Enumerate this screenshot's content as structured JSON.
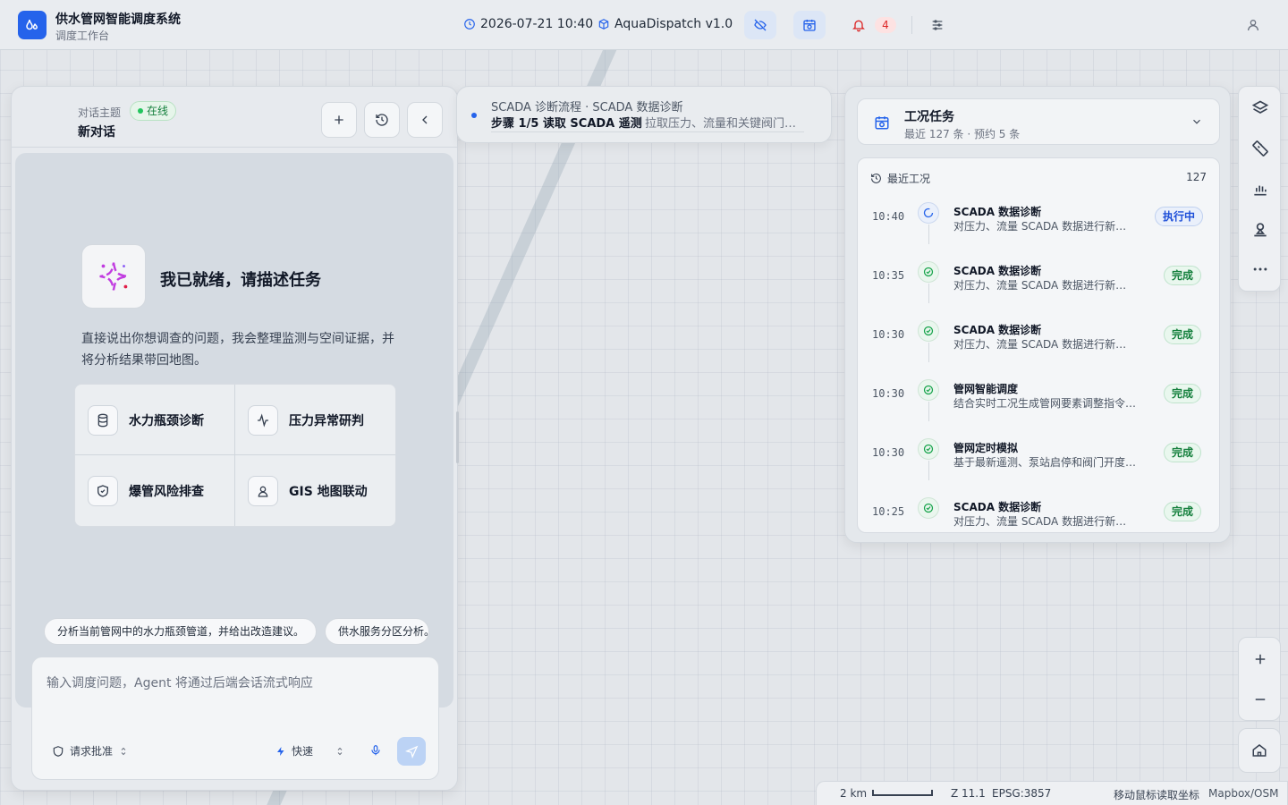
{
  "app": {
    "title": "供水管网智能调度系统",
    "subtitle": "调度工作台"
  },
  "topbar": {
    "datetime": "2026-07-21 10:40",
    "version": "AquaDispatch v1.0",
    "notification_count": "4",
    "icons": [
      "clock-icon",
      "cube-icon",
      "eye-off-icon",
      "calendar-sync-icon",
      "bell-icon",
      "sliders-icon",
      "user-icon"
    ]
  },
  "chat": {
    "topic_label": "对话主题",
    "status": "在线",
    "title": "新对话",
    "ready_title": "我已就绪，请描述任务",
    "ready_desc": "直接说出你想调查的问题，我会整理监测与空间证据，并将分析结果带回地图。",
    "quick_actions": [
      {
        "label": "水力瓶颈诊断",
        "icon": "database-icon"
      },
      {
        "label": "压力异常研判",
        "icon": "activity-icon"
      },
      {
        "label": "爆管风险排查",
        "icon": "shield-icon"
      },
      {
        "label": "GIS 地图联动",
        "icon": "map-pin-user-icon"
      }
    ],
    "suggestions": [
      "分析当前管网中的水力瓶颈管道，并给出改造建议。",
      "供水服务分区分析。"
    ],
    "input_placeholder": "输入调度问题，Agent 将通过后端会话流式响应",
    "approval_label": "请求批准",
    "mode_label": "快速"
  },
  "workflow": {
    "crumb": "SCADA 诊断流程 · SCADA 数据诊断",
    "step": "步骤 1/5 读取 SCADA 遥测",
    "detail": "拉取压力、流量和关键阀门…"
  },
  "tasks": {
    "title": "工况任务",
    "subtitle": "最近 127 条 · 预约 5 条",
    "list_label": "最近工况",
    "count": "127",
    "items": [
      {
        "time": "10:40",
        "name": "SCADA 数据诊断",
        "desc": "对压力、流量 SCADA 数据进行新鲜度检查",
        "status": "执行中",
        "state": "run"
      },
      {
        "time": "10:35",
        "name": "SCADA 数据诊断",
        "desc": "对压力、流量 SCADA 数据进行新鲜度检查",
        "status": "完成",
        "state": "done"
      },
      {
        "time": "10:30",
        "name": "SCADA 数据诊断",
        "desc": "对压力、流量 SCADA 数据进行新鲜度检查",
        "status": "完成",
        "state": "done"
      },
      {
        "time": "10:30",
        "name": "管网智能调度",
        "desc": "结合实时工况生成管网要素调整指令建议",
        "status": "完成",
        "state": "done"
      },
      {
        "time": "10:30",
        "name": "管网定时模拟",
        "desc": "基于最新遥测、泵站启停和阀门开度进行模拟",
        "status": "完成",
        "state": "done"
      },
      {
        "time": "10:25",
        "name": "SCADA 数据诊断",
        "desc": "对压力、流量 SCADA 数据进行新鲜度检查",
        "status": "完成",
        "state": "done"
      }
    ]
  },
  "map": {
    "scale": "2 km",
    "zoom": "Z 11.1",
    "crs": "EPSG:3857",
    "coord_hint": "移动鼠标读取坐标",
    "attribution": "Mapbox/OSM"
  }
}
